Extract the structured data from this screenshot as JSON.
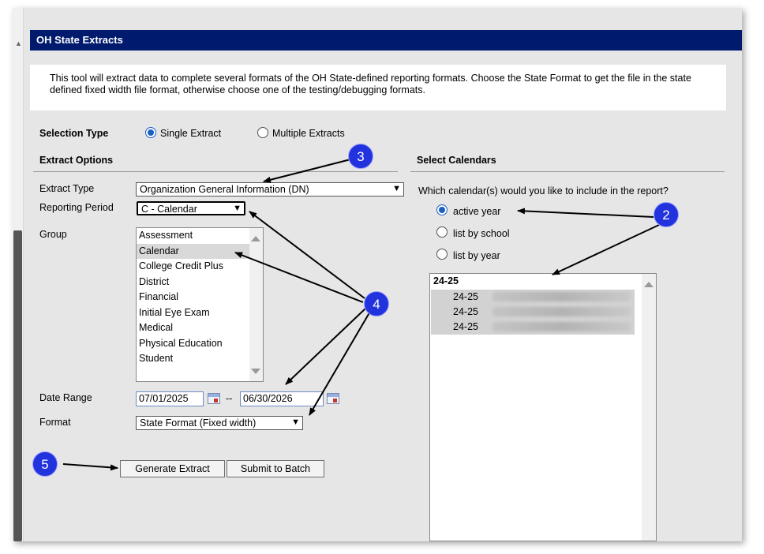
{
  "window": {
    "title": "OH State Extracts"
  },
  "description": "This tool will extract data to complete several formats of the OH State-defined reporting formats. Choose the State Format to get the file in the state defined fixed width file format, otherwise choose one of the testing/debugging formats.",
  "selection_type": {
    "label": "Selection Type",
    "options": [
      "Single Extract",
      "Multiple Extracts"
    ],
    "selected": "Single Extract"
  },
  "extract_options": {
    "heading": "Extract Options",
    "extract_type_label": "Extract Type",
    "extract_type_value": "Organization General Information (DN)",
    "reporting_period_label": "Reporting Period",
    "reporting_period_value": "C - Calendar",
    "group_label": "Group",
    "group_options": [
      "Assessment",
      "Calendar",
      "College Credit Plus",
      "District",
      "Financial",
      "Initial Eye Exam",
      "Medical",
      "Physical Education",
      "Student"
    ],
    "group_selected": "Calendar",
    "date_range_label": "Date Range",
    "date_start": "07/01/2025",
    "date_separator": "--",
    "date_end": "06/30/2026",
    "format_label": "Format",
    "format_value": "State Format (Fixed width)"
  },
  "buttons": {
    "generate": "Generate Extract",
    "submit": "Submit to Batch"
  },
  "calendars": {
    "heading": "Select Calendars",
    "question": "Which calendar(s) would you like to include in the report?",
    "options": [
      "active year",
      "list by school",
      "list by year"
    ],
    "selected": "active year",
    "list_header": "24-25",
    "items": [
      "24-25",
      "24-25",
      "24-25"
    ]
  },
  "callouts": [
    "2",
    "3",
    "4",
    "5"
  ],
  "colors": {
    "titlebar": "#001a6e",
    "callout": "#2233dd",
    "panel": "#e6e6e6"
  },
  "icons": [
    "calendar-picker-icon",
    "chevron-down-icon",
    "scroll-up-icon",
    "scroll-down-icon",
    "radio-icon",
    "arrow-icon"
  ]
}
